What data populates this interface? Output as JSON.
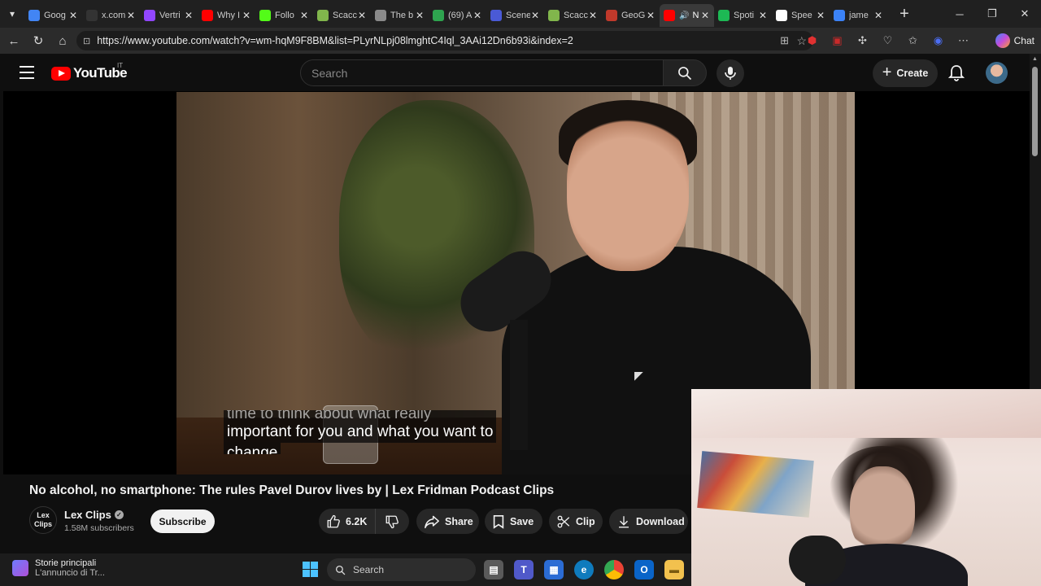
{
  "browser": {
    "tabs": [
      {
        "label": "Goog",
        "icon": "google-icon",
        "color": "#4285f4"
      },
      {
        "label": "x.com",
        "icon": "x-icon",
        "color": "#333333"
      },
      {
        "label": "Vertri",
        "icon": "twitch-icon",
        "color": "#9146ff"
      },
      {
        "label": "Why I",
        "icon": "youtube-icon",
        "color": "#ff0000"
      },
      {
        "label": "Follo",
        "icon": "kick-icon",
        "color": "#53fc18"
      },
      {
        "label": "Scacc",
        "icon": "chess-icon",
        "color": "#81b64c"
      },
      {
        "label": "The b",
        "icon": "chess-bot-icon",
        "color": "#8a8a8a"
      },
      {
        "label": "(69) A",
        "icon": "github-icon",
        "color": "#2ea44f"
      },
      {
        "label": "Scene",
        "icon": "scene-icon",
        "color": "#4a5ad6"
      },
      {
        "label": "Scacc",
        "icon": "chess-icon",
        "color": "#81b64c"
      },
      {
        "label": "GeoG",
        "icon": "geoguessr-icon",
        "color": "#c0392b"
      },
      {
        "label": "N",
        "icon": "youtube-icon",
        "color": "#ff0000",
        "active": true,
        "audio": true
      },
      {
        "label": "Spoti",
        "icon": "spotify-icon",
        "color": "#1db954"
      },
      {
        "label": "Spee",
        "icon": "speedtest-icon",
        "color": "#ffffff"
      },
      {
        "label": "jame",
        "icon": "search-icon",
        "color": "#3b82f6"
      }
    ],
    "url": "https://www.youtube.com/watch?v=wm-hqM9F8BM&list=PLyrNLpj08lmghtC4Iql_3AAi12Dn6b93i&index=2",
    "chat_label": "Chat"
  },
  "youtube": {
    "logo_text": "YouTube",
    "country_code": "IT",
    "search_placeholder": "Search",
    "create_label": "Create",
    "caption_line1": "time to think about what really",
    "caption_line2": "important for you and what you want to",
    "caption_line3": "change",
    "video_title": "No alcohol, no smartphone: The rules Pavel Durov lives by | Lex Fridman Podcast Clips",
    "channel_avatar_line1": "Lex",
    "channel_avatar_line2": "Clips",
    "channel_name": "Lex Clips",
    "subscribers": "1.58M subscribers",
    "subscribe_label": "Subscribe",
    "like_count": "6.2K",
    "share_label": "Share",
    "save_label": "Save",
    "clip_label": "Clip",
    "download_label": "Download"
  },
  "taskbar": {
    "news_title": "Storie principali",
    "news_subtitle": "L'annuncio di Tr...",
    "search_label": "Search",
    "apps": [
      "file-explorer-icon",
      "teams-icon",
      "store-icon",
      "edge-icon",
      "chrome-icon",
      "outlook-icon",
      "folder-icon"
    ]
  }
}
